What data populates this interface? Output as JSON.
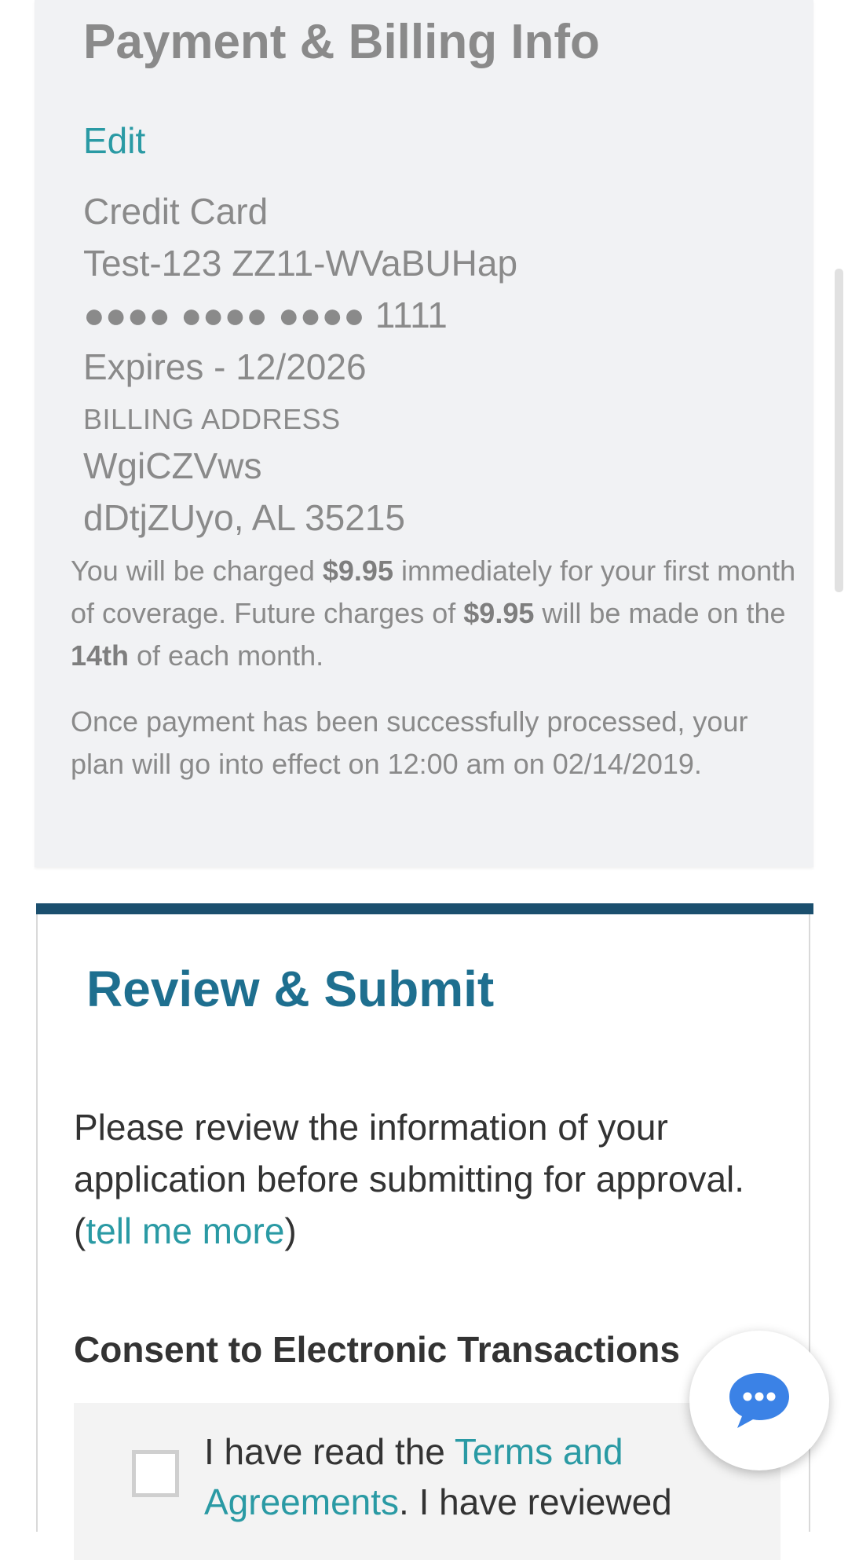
{
  "billing": {
    "title": "Payment & Billing Info",
    "edit_label": "Edit",
    "payment_method": "Credit Card",
    "card_name": "Test-123 ZZ11-WVaBUHap",
    "card_number_masked": "●●●● ●●●● ●●●● 1111",
    "expires": "Expires - 12/2026",
    "billing_address_label": "BILLING ADDRESS",
    "address_line1": "WgiCZVws",
    "address_line2": "dDtjZUyo, AL 35215",
    "charge_text_1": "You will be charged ",
    "charge_amount": "$9.95",
    "charge_text_2": " immediately for your first month of coverage. Future charges of ",
    "future_amount": "$9.95",
    "charge_text_3": " will be made on the ",
    "charge_day": "14th",
    "charge_text_4": " of each month.",
    "effect_text": "Once payment has been successfully processed, your plan will go into effect on 12:00 am on 02/14/2019."
  },
  "review": {
    "title": "Review & Submit",
    "intro_text": "Please review the information of your application before submitting for approval. (",
    "tell_more_link": "tell me more",
    "intro_close": ")",
    "consent_heading": "Consent to Electronic Transactions",
    "consent_text_1": "I have read the ",
    "terms_link": "Terms and Agreements",
    "consent_text_2": ". I have reviewed"
  },
  "chat": {
    "icon": "chat-bubble-icon",
    "color": "#3b82e6"
  },
  "colors": {
    "accent_link": "#2a9aa4",
    "review_title": "#1e6f8f",
    "review_bar": "#1b4f6e",
    "panel_bg": "#f1f2f4"
  }
}
